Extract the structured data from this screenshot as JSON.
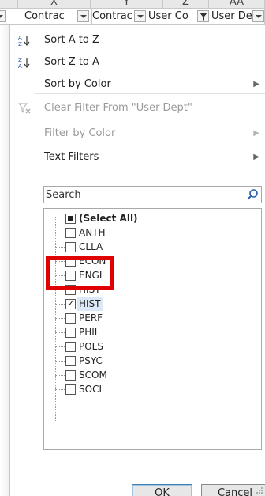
{
  "columns": {
    "letters": [
      "X",
      "Y",
      "Z",
      "AA"
    ],
    "headers": [
      "Contrac",
      "Contrac",
      "User Co",
      "User De"
    ]
  },
  "menu": {
    "sort_az": "Sort A to Z",
    "sort_za": "Sort Z to A",
    "sort_by_color": "Sort by Color",
    "clear_filter": "Clear Filter From \"User Dept\"",
    "filter_by_color": "Filter by Color",
    "text_filters": "Text Filters"
  },
  "search": {
    "placeholder": "Search"
  },
  "list": {
    "items": [
      {
        "label": "(Select All)",
        "state": "partial"
      },
      {
        "label": "ANTH",
        "state": "unchecked"
      },
      {
        "label": "CLLA",
        "state": "unchecked"
      },
      {
        "label": "ECON",
        "state": "unchecked"
      },
      {
        "label": "ENGL",
        "state": "unchecked"
      },
      {
        "label": "HIST",
        "state": "unchecked"
      },
      {
        "label": "HIST",
        "state": "checked"
      },
      {
        "label": "PERF",
        "state": "unchecked"
      },
      {
        "label": "PHIL",
        "state": "unchecked"
      },
      {
        "label": "POLS",
        "state": "unchecked"
      },
      {
        "label": "PSYC",
        "state": "unchecked"
      },
      {
        "label": "SCOM",
        "state": "unchecked"
      },
      {
        "label": "SOCI",
        "state": "unchecked"
      }
    ]
  },
  "buttons": {
    "ok": "OK",
    "cancel": "Cancel"
  },
  "colors": {
    "highlight": "#e10000",
    "selection": "#dbe8f8",
    "ok_border": "#3c7fb1"
  }
}
